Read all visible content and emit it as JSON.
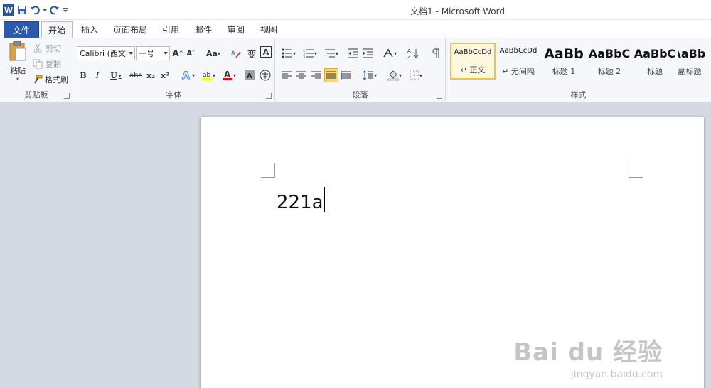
{
  "app": {
    "title": "文档1 - Microsoft Word"
  },
  "tabs": {
    "file": "文件",
    "items": [
      "开始",
      "插入",
      "页面布局",
      "引用",
      "邮件",
      "审阅",
      "视图"
    ],
    "active": "开始"
  },
  "clipboard": {
    "paste": "粘贴",
    "cut": "剪切",
    "copy": "复制",
    "format_painter": "格式刷",
    "group_label": "剪贴板"
  },
  "font": {
    "font_name": "Calibri (西文i",
    "font_size": "一号",
    "bold": "B",
    "italic": "I",
    "underline": "U",
    "strike": "abc",
    "subscript": "x₂",
    "superscript": "x²",
    "change_case": "Aa",
    "wen_char": "变",
    "char_border": "A",
    "group_label": "字体"
  },
  "paragraph": {
    "group_label": "段落"
  },
  "styles": {
    "group_label": "样式",
    "items": [
      {
        "sample": "AaBbCcDd",
        "name": "↵ 正文"
      },
      {
        "sample": "AaBbCcDd",
        "name": "↵ 无间隔"
      },
      {
        "sample": "AaBb",
        "name": "标题 1"
      },
      {
        "sample": "AaBbC",
        "name": "标题 2"
      },
      {
        "sample": "AaBbC",
        "name": "标题"
      },
      {
        "sample": "AaBb",
        "name": "副标题"
      }
    ],
    "selected_index": 0
  },
  "document": {
    "text": "221a"
  },
  "watermark": {
    "main": "Bai du 经验",
    "sub": "jingyan.baidu.com"
  },
  "colors": {
    "accent": "#2a5aa8",
    "highlight": "#ffff00",
    "font_color": "#e00000",
    "selected_style": "#f4c243"
  }
}
